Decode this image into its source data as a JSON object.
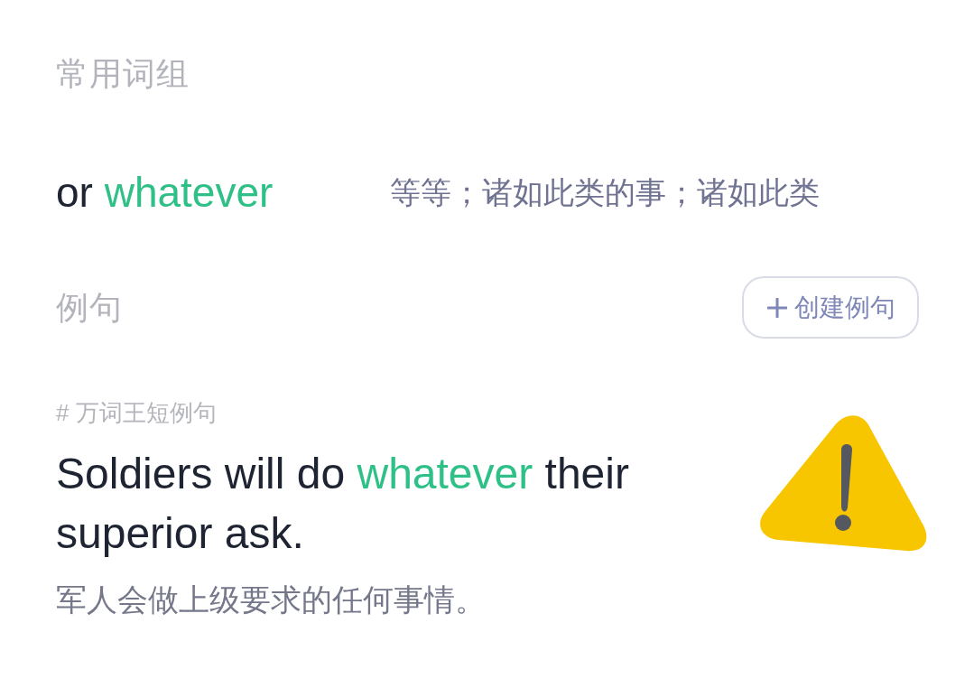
{
  "phrases_section": {
    "title": "常用词组",
    "phrases": [
      {
        "phrase": "or **whatever**",
        "meaning": "等等；诸如此类的事；诸如此类"
      }
    ]
  },
  "examples_section": {
    "title": "例句",
    "create_button": {
      "label": "创建例句"
    },
    "examples": [
      {
        "source": "# 万词王短例句",
        "sentence": "Soldiers will do **whatever** their superior ask.",
        "translation": "军人会做上级要求的任何事情。"
      }
    ]
  }
}
